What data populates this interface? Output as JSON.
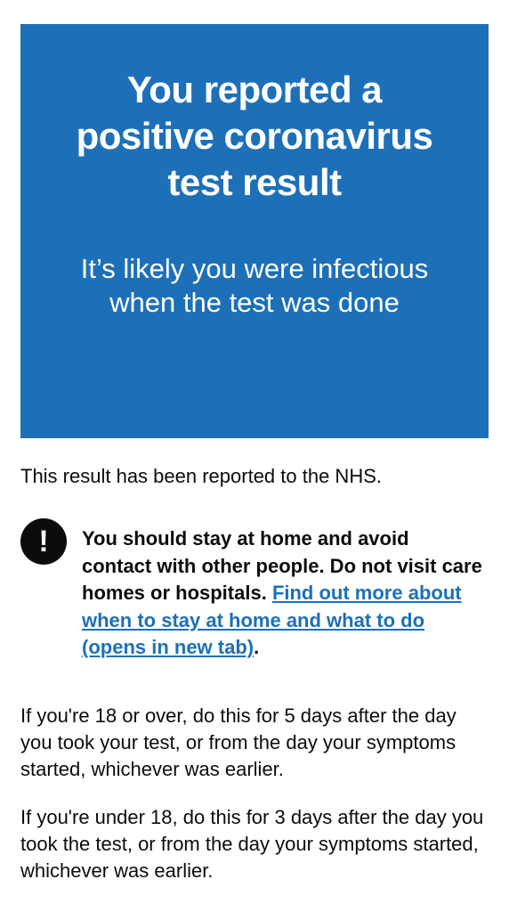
{
  "panel": {
    "title": "You reported a positive coronavirus test result",
    "body": "It’s likely you were infectious when the test was done",
    "background": "#1d70b8"
  },
  "reported_text": "This result has been reported to the NHS.",
  "warning": {
    "icon": "exclamation-icon",
    "icon_glyph": "!",
    "text": "You should stay at home and avoid contact with other people. Do not visit care homes or hospitals. ",
    "link": "Find out more about when to stay at home and what to do (opens in new tab)",
    "trailing": ".",
    "link_color": "#1d70b8"
  },
  "paragraphs": [
    "If you're 18 or over, do this for 5 days after the day you took your test, or from the day your symptoms started, whichever was earlier.",
    "If you're under 18, do this for 3 days after the day you took the test, or from the day your symptoms started, whichever was earlier."
  ]
}
